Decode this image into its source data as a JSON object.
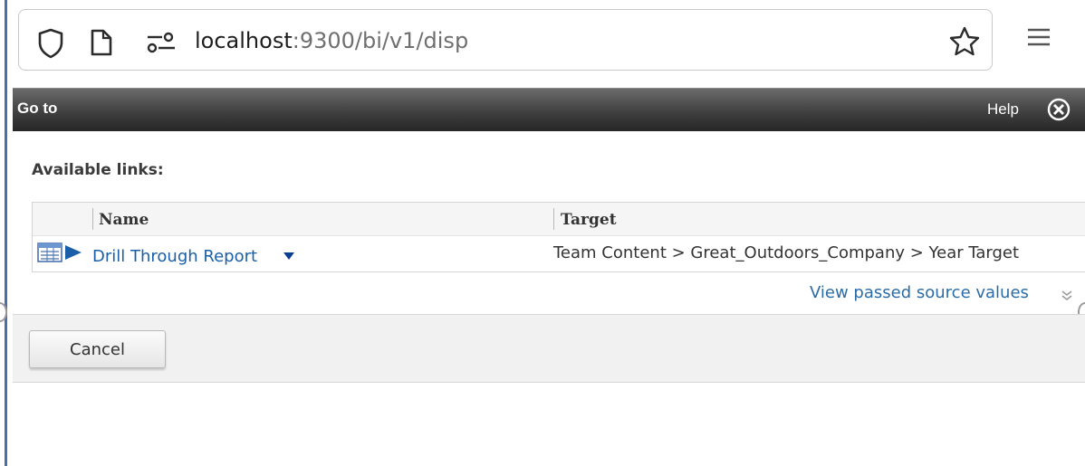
{
  "browser": {
    "url_host": "localhost",
    "url_rest": ":9300/bi/v1/disp",
    "icons": [
      "shield-icon",
      "page-icon",
      "permissions-icon",
      "bookmark-star-icon",
      "menu-icon"
    ]
  },
  "dialog": {
    "title": "Go to",
    "help_label": "Help",
    "close_icon": "close-circle-icon",
    "section_label": "Available links:",
    "table": {
      "columns": [
        "Name",
        "Target"
      ],
      "rows": [
        {
          "icon": "report-run-icon",
          "name": "Drill Through Report",
          "target": "Team Content > Great_Outdoors_Company > Year Target"
        }
      ]
    },
    "view_source_values_label": "View passed source values",
    "cancel_label": "Cancel"
  },
  "colors": {
    "header_dark": "#404040",
    "link_blue": "#1a5fa8",
    "accent_line": "#4a6fa8",
    "footer_bg": "#f1f1f1"
  }
}
